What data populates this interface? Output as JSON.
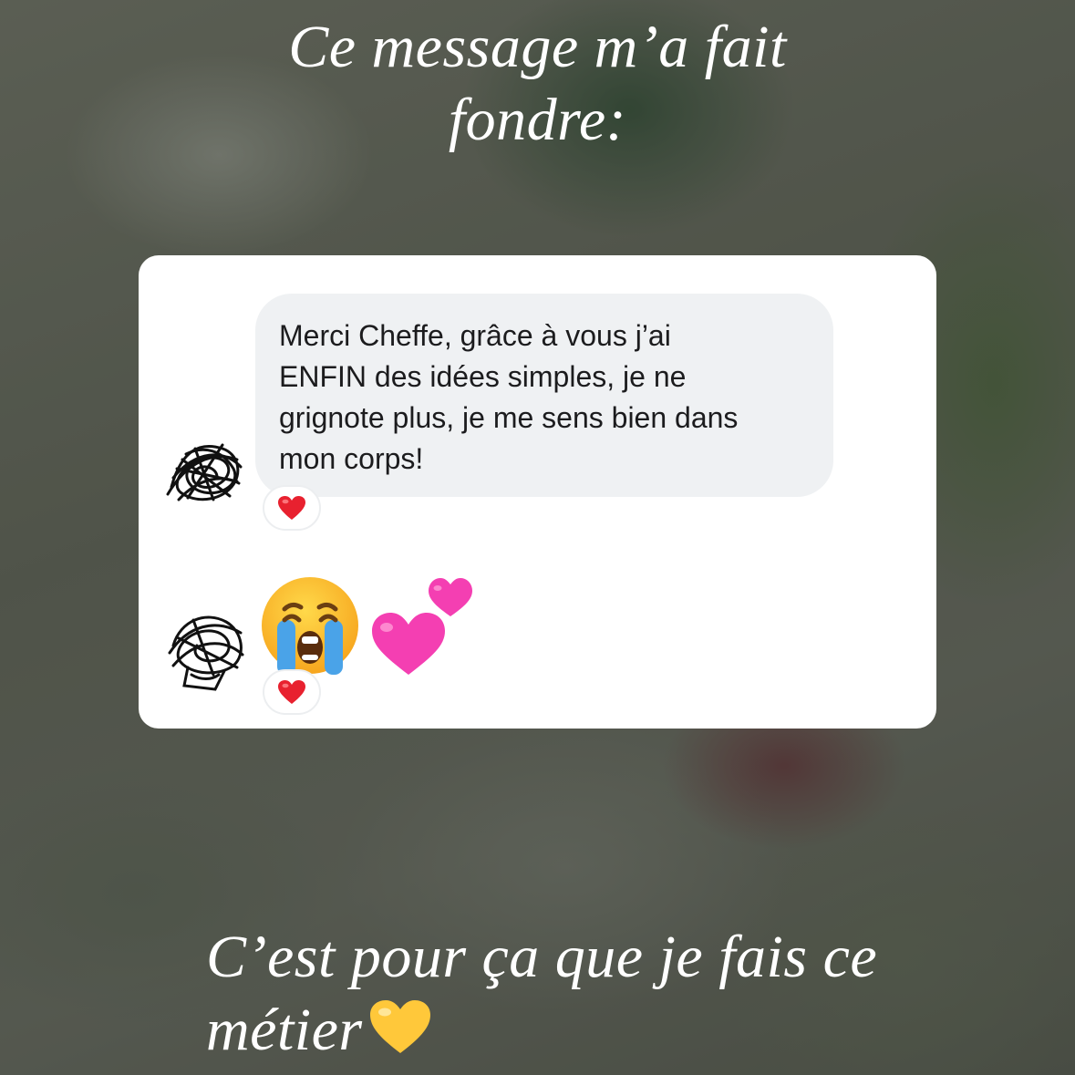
{
  "story": {
    "top_caption": [
      "Ce message m’a fait",
      "fondre:"
    ],
    "bottom_caption": [
      "C’est pour ça que je fais ce",
      "métier"
    ]
  },
  "conversation": {
    "message_1": {
      "text_lines": [
        "Merci Cheffe, grâce à vous j’ai",
        "ENFIN des idées simples, je ne",
        "grignote plus, je me sens bien dans",
        "mon corps!"
      ],
      "reaction": "red-heart-icon"
    },
    "message_2": {
      "emojis": [
        "loudly-crying-face-icon",
        "two-hearts-icon"
      ],
      "reaction": "red-heart-icon"
    }
  },
  "icons": {
    "caption_end": "yellow-heart-icon",
    "avatars": "scribbled-avatar-icon"
  },
  "colors": {
    "card_background": "#ffffff",
    "bubble_background": "#eff1f3",
    "bubble_text": "#1c1c1e",
    "caption_text": "#ffffff",
    "reaction_heart": "#e8212f",
    "pink_heart": "#f43fb2",
    "yellow_heart": "#ffc83a"
  }
}
